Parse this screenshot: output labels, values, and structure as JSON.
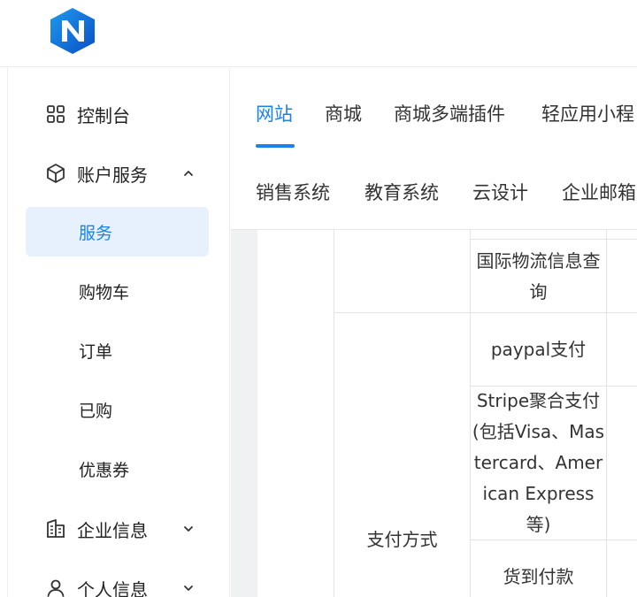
{
  "header": {
    "logo_name": "N"
  },
  "sidebar": {
    "items": [
      {
        "label": "控制台",
        "icon": "grid-icon"
      },
      {
        "label": "账户服务",
        "icon": "box-icon",
        "expanded": true
      },
      {
        "label": "企业信息",
        "icon": "building-icon",
        "expanded": false
      },
      {
        "label": "个人信息",
        "icon": "user-icon",
        "expanded": false
      }
    ],
    "subitems": [
      {
        "label": "服务",
        "active": true
      },
      {
        "label": "购物车"
      },
      {
        "label": "订单"
      },
      {
        "label": "已购"
      },
      {
        "label": "优惠券"
      }
    ]
  },
  "tabs": {
    "row1": [
      "网站",
      "商城",
      "商城多端插件",
      "轻应用小程"
    ],
    "row2": [
      "销售系统",
      "教育系统",
      "云设计",
      "企业邮箱"
    ],
    "active": "网站"
  },
  "table": {
    "group_label": "支付方式",
    "rows": [
      "国际物流信息查询",
      "paypal支付",
      "Stripe聚合支付(包括Visa、Mastercard、American Express等)",
      "货到付款"
    ]
  },
  "colors": {
    "accent": "#1a82e8",
    "active_bg": "#e6f1fd",
    "content_bg": "#f0f1f3"
  }
}
